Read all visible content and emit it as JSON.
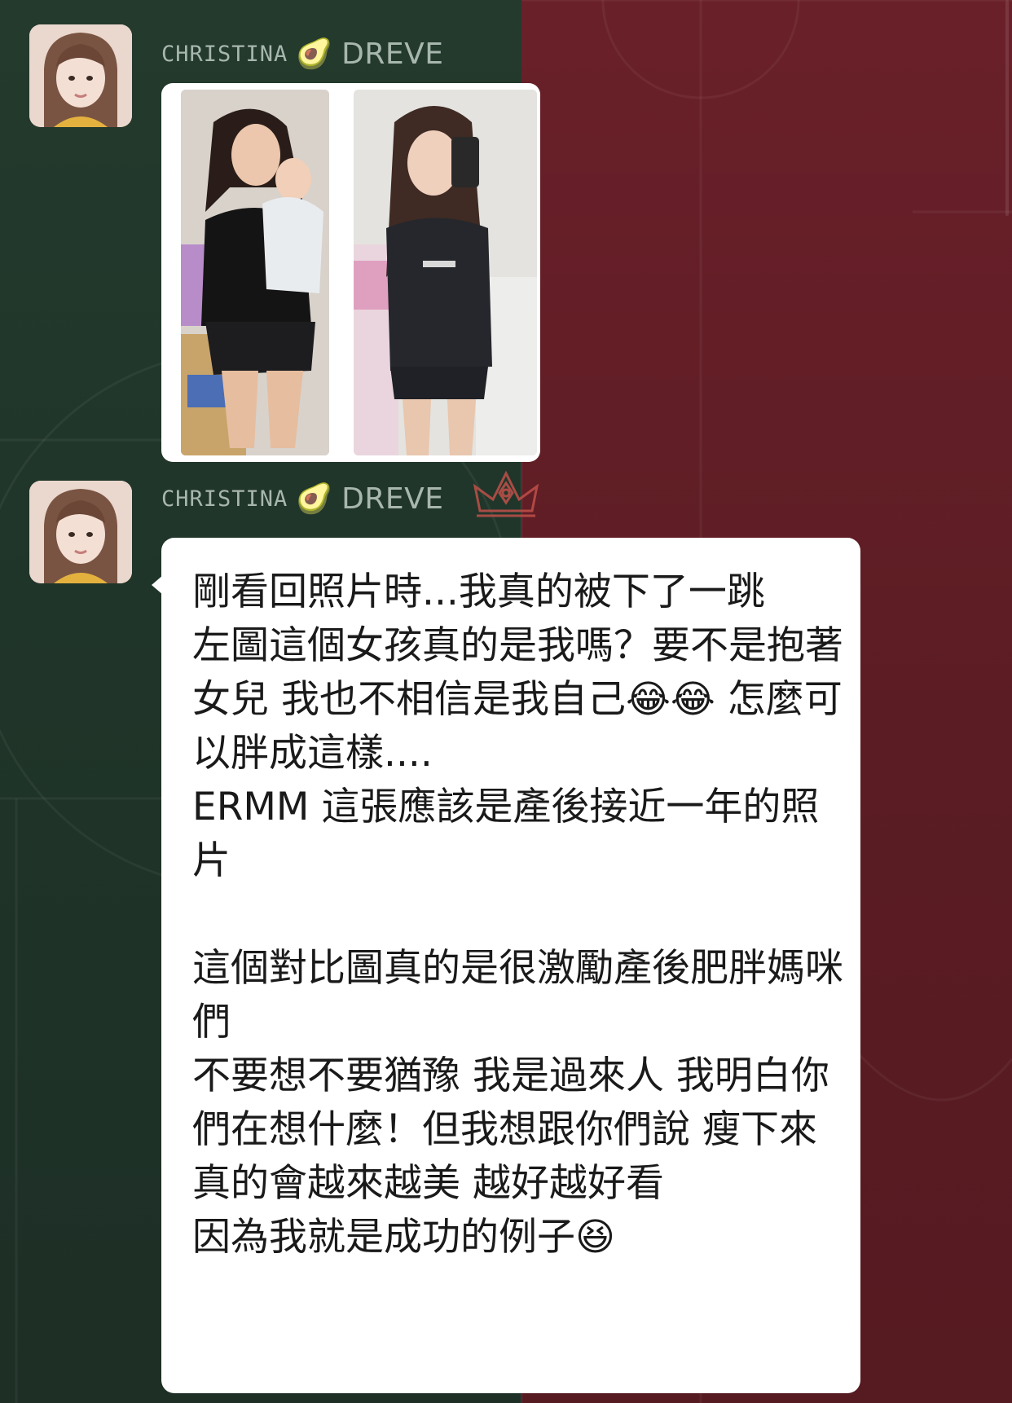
{
  "colors": {
    "left_background": "#233a2d",
    "right_background": "#6a2029",
    "bubble_background": "#ffffff",
    "sender_name_color": "#a8b7ae",
    "message_text_color": "#1a1a1a",
    "crown_color": "#c0504a"
  },
  "messages": [
    {
      "sender": {
        "first": "CHRISTINA",
        "emoji": "🥑",
        "last": "DREVE"
      },
      "type": "image",
      "avatar_icon": "user-avatar"
    },
    {
      "sender": {
        "first": "CHRISTINA",
        "emoji": "🥑",
        "last": "DREVE"
      },
      "type": "text",
      "avatar_icon": "user-avatar",
      "badge_icon": "crown-icon",
      "text": "剛看回照片時...我真的被下了一跳\n左圖這個女孩真的是我嗎？要不是抱著女兒 我也不相信是我自己😂😂 怎麼可以胖成這樣....\nERMM 這張應該是產後接近一年的照片\n\n這個對比圖真的是很激勵產後肥胖媽咪們\n不要想不要猶豫 我是過來人 我明白你們在想什麼！但我想跟你們說 瘦下來真的會越來越美 越好越好看\n因為我就是成功的例子😆"
    }
  ]
}
